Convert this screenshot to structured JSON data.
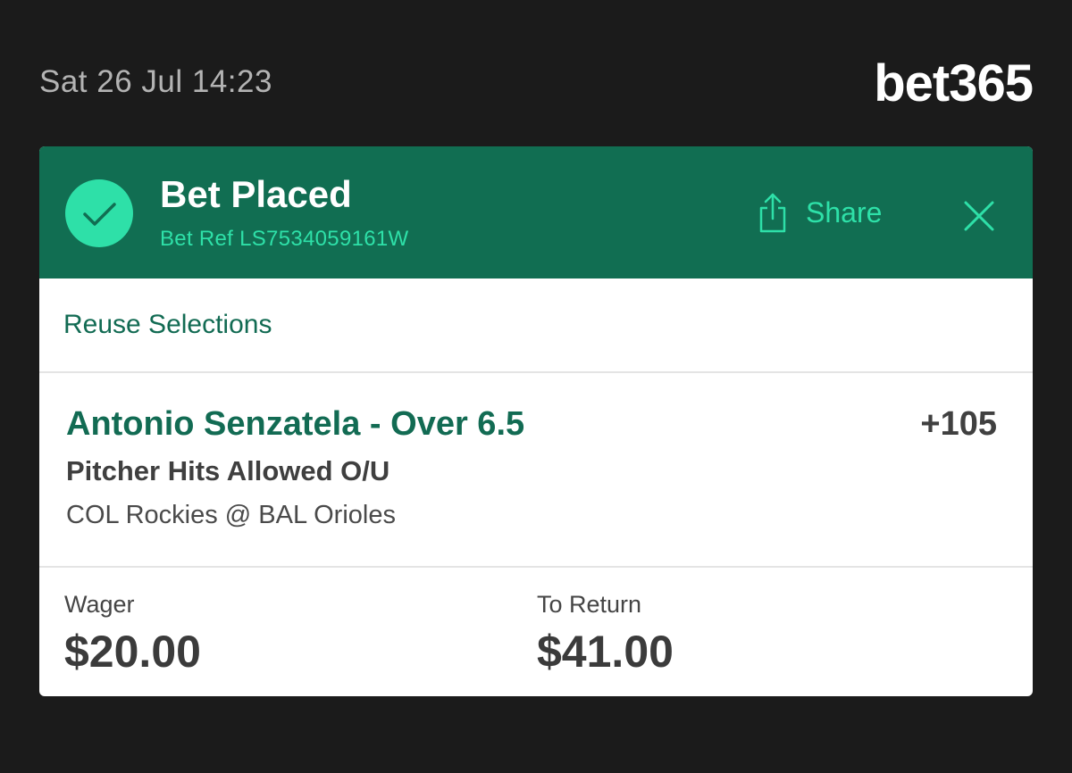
{
  "status_bar": {
    "timestamp": "Sat 26 Jul 14:23",
    "brand": "bet365"
  },
  "header": {
    "title": "Bet Placed",
    "bet_ref": "Bet Ref LS7534059161W",
    "share_label": "Share",
    "icons": {
      "success": "check-icon",
      "share": "share-icon",
      "close": "close-icon"
    }
  },
  "reuse": {
    "label": "Reuse Selections"
  },
  "selection": {
    "title": "Antonio Senzatela - Over 6.5",
    "odds": "+105",
    "market": "Pitcher Hits Allowed O/U",
    "event": "COL Rockies @ BAL Orioles"
  },
  "totals": {
    "wager_label": "Wager",
    "wager_value": "$20.00",
    "return_label": "To Return",
    "return_value": "$41.00"
  },
  "colors": {
    "background": "#1b1b1b",
    "header_green": "#116e52",
    "accent_mint": "#2ee0a8",
    "text_green": "#126b53"
  }
}
